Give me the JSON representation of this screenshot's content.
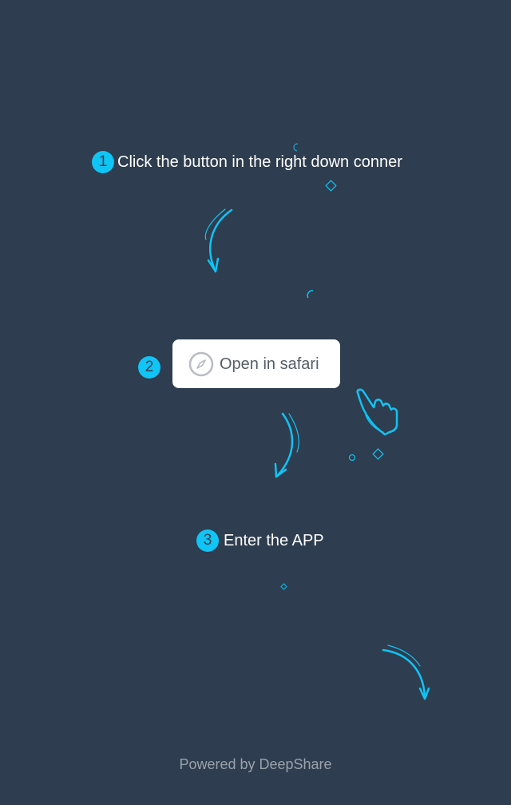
{
  "steps": [
    {
      "number": "1",
      "text": "Click the button in the right down conner"
    },
    {
      "number": "2",
      "button_label": "Open in safari",
      "button_icon": "compass-icon"
    },
    {
      "number": "3",
      "text": "Enter the APP"
    }
  ],
  "footer": {
    "text": "Powered by DeepShare"
  },
  "colors": {
    "background": "#2e3d4f",
    "accent": "#10c4f5",
    "button_bg": "#ffffff",
    "button_text": "#555d66",
    "footer_text": "#9aa2ab"
  }
}
